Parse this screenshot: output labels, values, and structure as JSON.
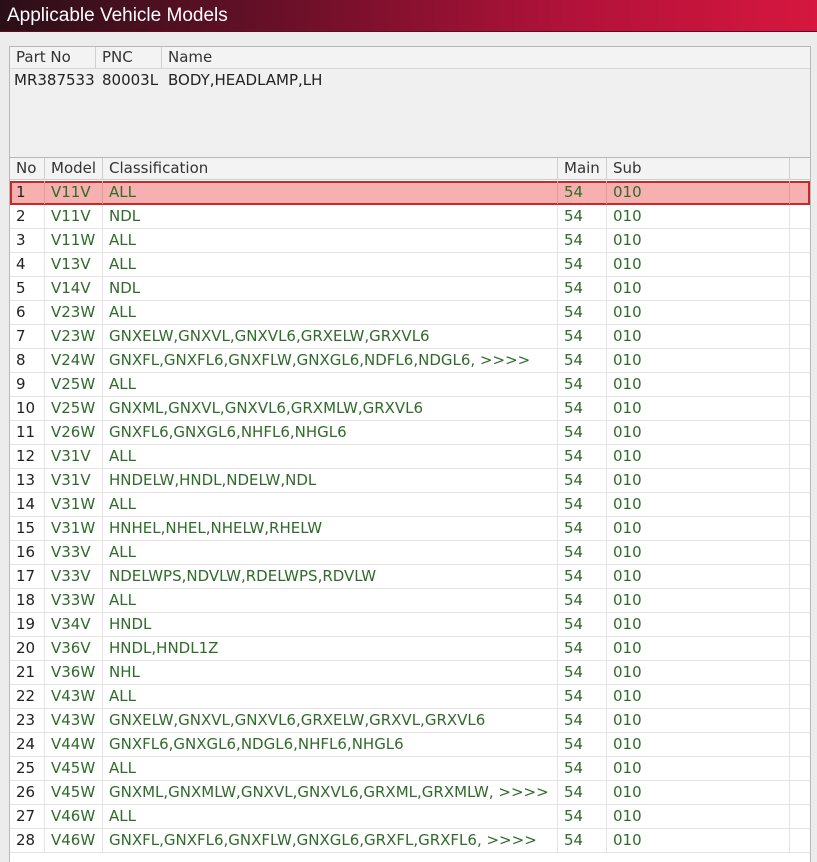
{
  "window": {
    "title": "Applicable Vehicle Models"
  },
  "part_info": {
    "headers": [
      "Part No",
      "PNC",
      "Name"
    ],
    "part_no": "MR387533",
    "pnc": "80003L",
    "name": "BODY,HEADLAMP,LH"
  },
  "models_table": {
    "headers": [
      "No",
      "Model",
      "Classification",
      "Main",
      "Sub"
    ],
    "selected_row": 1,
    "rows": [
      {
        "no": "1",
        "model": "V11V",
        "classification": "ALL",
        "main": "54",
        "sub": "010"
      },
      {
        "no": "2",
        "model": "V11V",
        "classification": "NDL",
        "main": "54",
        "sub": "010"
      },
      {
        "no": "3",
        "model": "V11W",
        "classification": "ALL",
        "main": "54",
        "sub": "010"
      },
      {
        "no": "4",
        "model": "V13V",
        "classification": "ALL",
        "main": "54",
        "sub": "010"
      },
      {
        "no": "5",
        "model": "V14V",
        "classification": "NDL",
        "main": "54",
        "sub": "010"
      },
      {
        "no": "6",
        "model": "V23W",
        "classification": "ALL",
        "main": "54",
        "sub": "010"
      },
      {
        "no": "7",
        "model": "V23W",
        "classification": "GNXELW,GNXVL,GNXVL6,GRXELW,GRXVL6",
        "main": "54",
        "sub": "010"
      },
      {
        "no": "8",
        "model": "V24W",
        "classification": "GNXFL,GNXFL6,GNXFLW,GNXGL6,NDFL6,NDGL6,  >>>>",
        "main": "54",
        "sub": "010"
      },
      {
        "no": "9",
        "model": "V25W",
        "classification": "ALL",
        "main": "54",
        "sub": "010"
      },
      {
        "no": "10",
        "model": "V25W",
        "classification": "GNXML,GNXVL,GNXVL6,GRXMLW,GRXVL6",
        "main": "54",
        "sub": "010"
      },
      {
        "no": "11",
        "model": "V26W",
        "classification": "GNXFL6,GNXGL6,NHFL6,NHGL6",
        "main": "54",
        "sub": "010"
      },
      {
        "no": "12",
        "model": "V31V",
        "classification": "ALL",
        "main": "54",
        "sub": "010"
      },
      {
        "no": "13",
        "model": "V31V",
        "classification": "HNDELW,HNDL,NDELW,NDL",
        "main": "54",
        "sub": "010"
      },
      {
        "no": "14",
        "model": "V31W",
        "classification": "ALL",
        "main": "54",
        "sub": "010"
      },
      {
        "no": "15",
        "model": "V31W",
        "classification": "HNHEL,NHEL,NHELW,RHELW",
        "main": "54",
        "sub": "010"
      },
      {
        "no": "16",
        "model": "V33V",
        "classification": "ALL",
        "main": "54",
        "sub": "010"
      },
      {
        "no": "17",
        "model": "V33V",
        "classification": "NDELWPS,NDVLW,RDELWPS,RDVLW",
        "main": "54",
        "sub": "010"
      },
      {
        "no": "18",
        "model": "V33W",
        "classification": "ALL",
        "main": "54",
        "sub": "010"
      },
      {
        "no": "19",
        "model": "V34V",
        "classification": "HNDL",
        "main": "54",
        "sub": "010"
      },
      {
        "no": "20",
        "model": "V36V",
        "classification": "HNDL,HNDL1Z",
        "main": "54",
        "sub": "010"
      },
      {
        "no": "21",
        "model": "V36W",
        "classification": "NHL",
        "main": "54",
        "sub": "010"
      },
      {
        "no": "22",
        "model": "V43W",
        "classification": "ALL",
        "main": "54",
        "sub": "010"
      },
      {
        "no": "23",
        "model": "V43W",
        "classification": "GNXELW,GNXVL,GNXVL6,GRXELW,GRXVL,GRXVL6",
        "main": "54",
        "sub": "010"
      },
      {
        "no": "24",
        "model": "V44W",
        "classification": "GNXFL6,GNXGL6,NDGL6,NHFL6,NHGL6",
        "main": "54",
        "sub": "010"
      },
      {
        "no": "25",
        "model": "V45W",
        "classification": "ALL",
        "main": "54",
        "sub": "010"
      },
      {
        "no": "26",
        "model": "V45W",
        "classification": "GNXML,GNXMLW,GNXVL,GNXVL6,GRXML,GRXMLW,  >>>>",
        "main": "54",
        "sub": "010"
      },
      {
        "no": "27",
        "model": "V46W",
        "classification": "ALL",
        "main": "54",
        "sub": "010"
      },
      {
        "no": "28",
        "model": "V46W",
        "classification": "GNXFL,GNXFL6,GNXFLW,GNXGL6,GRXFL,GRXFL6,  >>>>",
        "main": "54",
        "sub": "010"
      }
    ]
  },
  "colors": {
    "title_gradient_end": "#d6173f",
    "selected_row_bg": "#f7b0b0",
    "selected_row_border": "#c42a2a",
    "classification_text": "#2f6b2a"
  }
}
